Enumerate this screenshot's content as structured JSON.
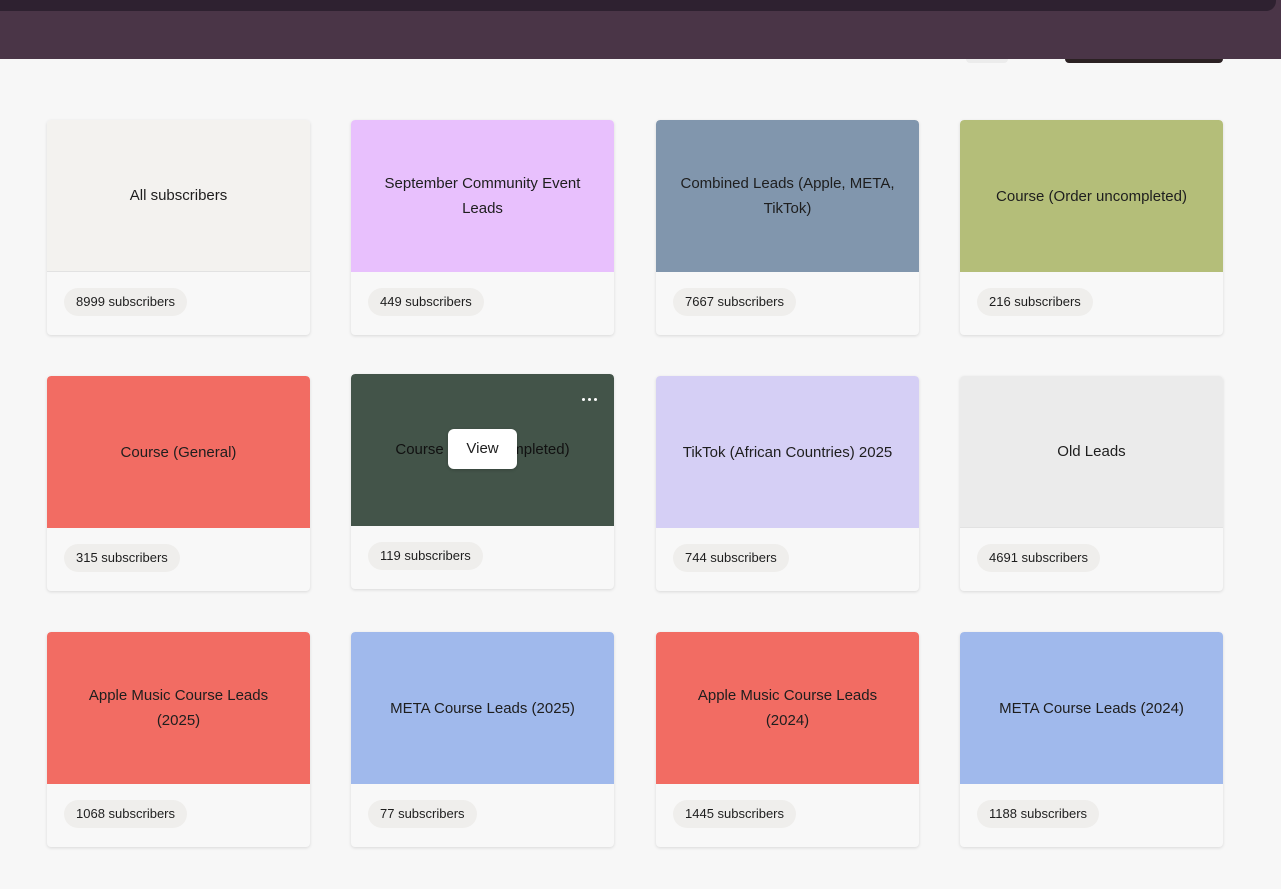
{
  "cards": [
    {
      "title": "All subscribers",
      "count": "8999 subscribers",
      "color": "#f3f2ef"
    },
    {
      "title": "September Community Event Leads",
      "count": "449 subscribers",
      "color": "#e8c0fd"
    },
    {
      "title": "Combined Leads (Apple, META, TikTok)",
      "count": "7667 subscribers",
      "color": "#8196ad"
    },
    {
      "title": "Course (Order uncompleted)",
      "count": "216 subscribers",
      "color": "#b4be79"
    },
    {
      "title": "Course (General)",
      "count": "315 subscribers",
      "color": "#f26c63"
    },
    {
      "title": "Course (Order completed)",
      "count": "119 subscribers",
      "color": "#435449"
    },
    {
      "title": "TikTok (African Countries) 2025",
      "count": "744 subscribers",
      "color": "#d5cff5"
    },
    {
      "title": "Old Leads",
      "count": "4691 subscribers",
      "color": "#ebebeb"
    },
    {
      "title": "Apple Music Course Leads (2025)",
      "count": "1068 subscribers",
      "color": "#f26c63"
    },
    {
      "title": "META Course Leads (2025)",
      "count": "77 subscribers",
      "color": "#a0b9ec"
    },
    {
      "title": "Apple Music Course Leads (2024)",
      "count": "1445 subscribers",
      "color": "#f26c63"
    },
    {
      "title": "META Course Leads (2024)",
      "count": "1188 subscribers",
      "color": "#a0b9ec"
    }
  ],
  "hover_card": {
    "view_label": "View",
    "more_icon": "more-horizontal-icon"
  }
}
